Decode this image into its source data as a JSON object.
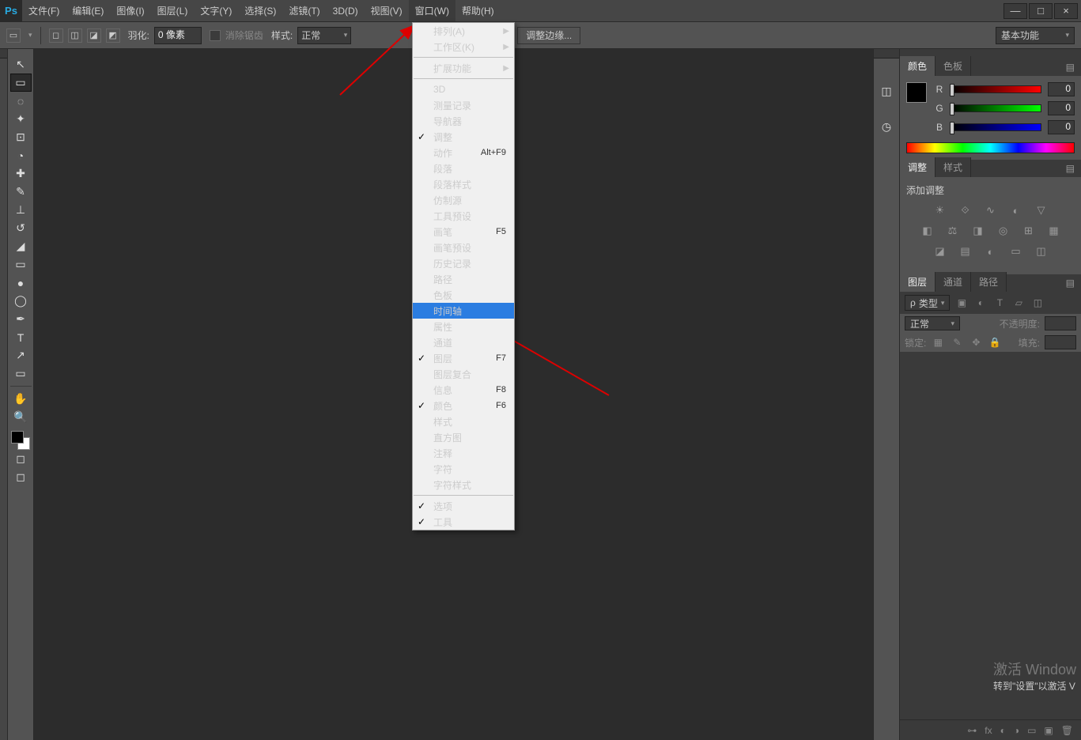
{
  "menubar": {
    "items": [
      "文件(F)",
      "编辑(E)",
      "图像(I)",
      "图层(L)",
      "文字(Y)",
      "选择(S)",
      "滤镜(T)",
      "3D(D)",
      "视图(V)",
      "窗口(W)",
      "帮助(H)"
    ],
    "open_index": 9
  },
  "optionsbar": {
    "feather_label": "羽化:",
    "feather_value": "0 像素",
    "antialias_label": "消除锯齿",
    "style_label": "样式:",
    "style_value": "正常",
    "refine_edge": "调整边缘...",
    "workspace": "基本功能"
  },
  "dropdown": {
    "items": [
      {
        "type": "item",
        "label": "排列(A)",
        "submenu": true
      },
      {
        "type": "item",
        "label": "工作区(K)",
        "submenu": true
      },
      {
        "type": "sep"
      },
      {
        "type": "item",
        "label": "扩展功能",
        "submenu": true,
        "disabled": true
      },
      {
        "type": "sep"
      },
      {
        "type": "item",
        "label": "3D"
      },
      {
        "type": "item",
        "label": "测量记录"
      },
      {
        "type": "item",
        "label": "导航器"
      },
      {
        "type": "item",
        "label": "调整",
        "checked": true
      },
      {
        "type": "item",
        "label": "动作",
        "shortcut": "Alt+F9"
      },
      {
        "type": "item",
        "label": "段落"
      },
      {
        "type": "item",
        "label": "段落样式"
      },
      {
        "type": "item",
        "label": "仿制源"
      },
      {
        "type": "item",
        "label": "工具预设"
      },
      {
        "type": "item",
        "label": "画笔",
        "shortcut": "F5"
      },
      {
        "type": "item",
        "label": "画笔预设"
      },
      {
        "type": "item",
        "label": "历史记录"
      },
      {
        "type": "item",
        "label": "路径"
      },
      {
        "type": "item",
        "label": "色板"
      },
      {
        "type": "item",
        "label": "时间轴",
        "highlight": true
      },
      {
        "type": "item",
        "label": "属性"
      },
      {
        "type": "item",
        "label": "通道"
      },
      {
        "type": "item",
        "label": "图层",
        "shortcut": "F7",
        "checked": true
      },
      {
        "type": "item",
        "label": "图层复合"
      },
      {
        "type": "item",
        "label": "信息",
        "shortcut": "F8"
      },
      {
        "type": "item",
        "label": "颜色",
        "shortcut": "F6",
        "checked": true
      },
      {
        "type": "item",
        "label": "样式"
      },
      {
        "type": "item",
        "label": "直方图"
      },
      {
        "type": "item",
        "label": "注释"
      },
      {
        "type": "item",
        "label": "字符"
      },
      {
        "type": "item",
        "label": "字符样式"
      },
      {
        "type": "sep"
      },
      {
        "type": "item",
        "label": "选项",
        "checked": true
      },
      {
        "type": "item",
        "label": "工具",
        "checked": true
      }
    ]
  },
  "panels": {
    "color": {
      "tabs": [
        "颜色",
        "色板"
      ],
      "active": 0,
      "r_label": "R",
      "g_label": "G",
      "b_label": "B",
      "r_value": "0",
      "g_value": "0",
      "b_value": "0"
    },
    "adjustments": {
      "tabs": [
        "调整",
        "样式"
      ],
      "active": 0,
      "heading": "添加调整"
    },
    "layers": {
      "tabs": [
        "图层",
        "通道",
        "路径"
      ],
      "active": 0,
      "kind_label": "类型",
      "blend_mode": "正常",
      "opacity_label": "不透明度:",
      "lock_label": "锁定:",
      "fill_label": "填充:"
    }
  },
  "watermark": {
    "line1": "激活 Window",
    "line2": "转到\"设置\"以激活 V"
  }
}
